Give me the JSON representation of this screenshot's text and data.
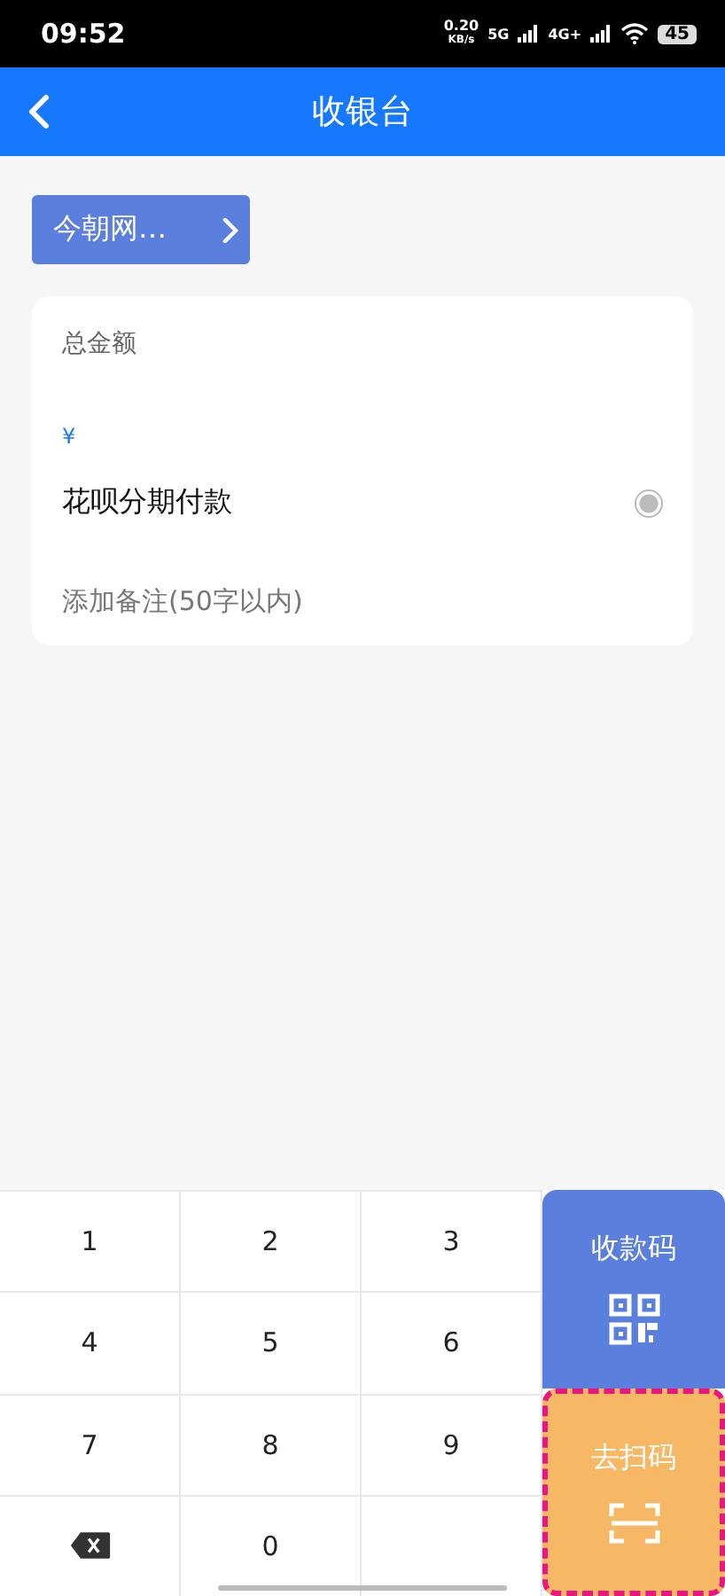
{
  "status_bar": {
    "time": "09:52",
    "speed": "0.20",
    "speed_unit": "KB/s",
    "network_1": "5G",
    "network_2": "4G+",
    "battery": "45"
  },
  "app_bar": {
    "title": "收银台"
  },
  "merchant": {
    "label": "今朝网…"
  },
  "card": {
    "amount_label": "总金额",
    "currency": "¥",
    "installment": {
      "label": "花呗分期付款",
      "checked": true
    },
    "note": {
      "placeholder": "添加备注(50字以内)"
    }
  },
  "keypad": [
    {
      "kind": "digit",
      "label": "1"
    },
    {
      "kind": "digit",
      "label": "2"
    },
    {
      "kind": "digit",
      "label": "3"
    },
    {
      "kind": "digit",
      "label": "4"
    },
    {
      "kind": "digit",
      "label": "5"
    },
    {
      "kind": "digit",
      "label": "6"
    },
    {
      "kind": "digit",
      "label": "7"
    },
    {
      "kind": "digit",
      "label": "8"
    },
    {
      "kind": "digit",
      "label": "9"
    },
    {
      "kind": "delete"
    },
    {
      "kind": "digit",
      "label": "0"
    }
  ],
  "actions": [
    {
      "kind": "qr",
      "label": "收款码",
      "highlighted": false
    },
    {
      "kind": "scan",
      "label": "去扫码",
      "highlighted": true
    }
  ]
}
